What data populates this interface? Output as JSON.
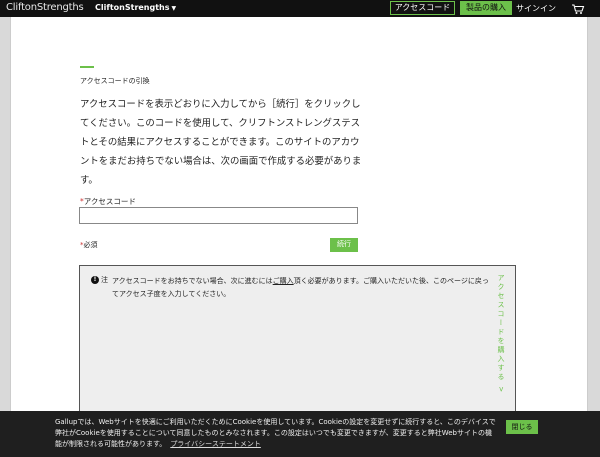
{
  "header": {
    "brand": "CliftonStrengths",
    "brand_menu": "CliftonStrengths",
    "access_code_button": "アクセスコード",
    "buy_button": "製品の購入",
    "signin": "サインイン",
    "cart_icon": "cart-icon"
  },
  "main": {
    "section_label": "アクセスコードの引換",
    "intro": "アクセスコードを表示どおりに入力してから［続行］をクリックしてください。このコードを使用して、クリフトンストレングステストとその結果にアクセスすることができます。このサイトのアカウントをまだお持ちでない場合は、次の画面で作成する必要があります。",
    "field_label": "アクセスコード",
    "field_value": "",
    "required_star": "*",
    "required_note": "必須",
    "continue_button": "続行"
  },
  "notice": {
    "icon": "info-icon",
    "tag": "注",
    "text_before": "アクセスコードをお持ちでない場合、次に進むには",
    "link_text": "ご購入",
    "text_after": "頂く必要があります。ご購入いただいた後、このページに戻ってアクセス子度を入力してください。",
    "vertical_link": "アクセスコードを購入する >"
  },
  "cookie": {
    "text": "Gallupでは、Webサイトを快適にご利用いただくためにCookieを使用しています。Cookieの設定を変更せずに続行すると、このデバイスで弊社がCookieを使用することについて同意したものとみなされます。この設定はいつでも変更できますが、変更すると弊社Webサイトの機能が制限される可能性があります。",
    "link": "プライバシーステートメント",
    "close_button": "閉じる"
  },
  "colors": {
    "accent_green": "#6cc04a",
    "nav_bg": "#111111",
    "cookie_bg": "#1f1f1f",
    "notice_bg": "#eeeeee"
  }
}
